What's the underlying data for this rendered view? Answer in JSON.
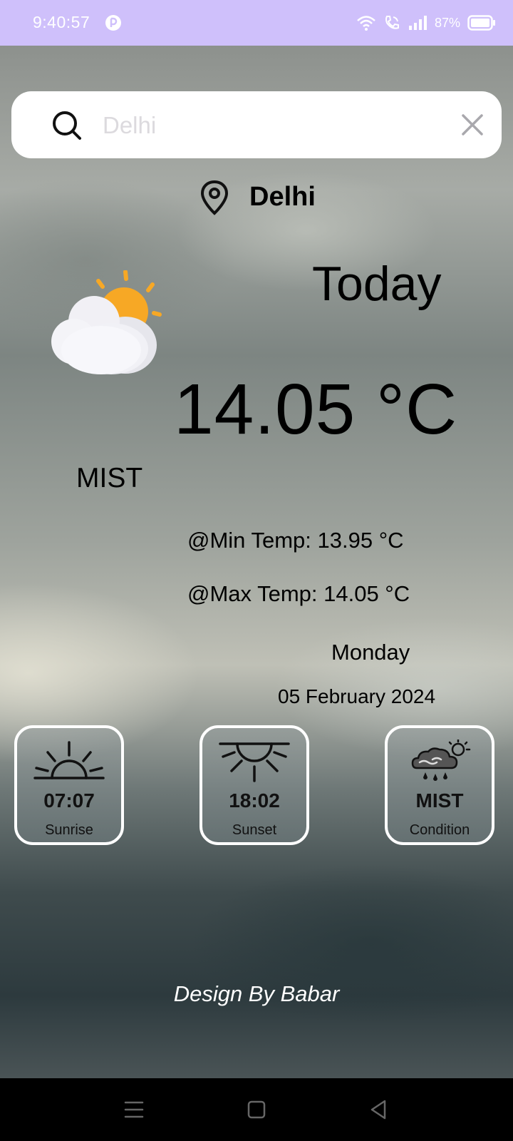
{
  "status_bar": {
    "time": "9:40:57",
    "battery_percent": "87%"
  },
  "search": {
    "placeholder": "Delhi",
    "value": ""
  },
  "location": {
    "city": "Delhi"
  },
  "weather": {
    "today_label": "Today",
    "temperature": "14.05 °C",
    "condition": "MIST",
    "min_temp": "@Min Temp: 13.95 °C",
    "max_temp": "@Max Temp: 14.05 °C",
    "day": "Monday",
    "date": "05 February 2024",
    "icon": "partly-cloudy-icon"
  },
  "cards": [
    {
      "icon": "sunrise-icon",
      "value": "07:07",
      "label": "Sunrise"
    },
    {
      "icon": "sunset-icon",
      "value": "18:02",
      "label": "Sunset"
    },
    {
      "icon": "condition-icon",
      "value": "MIST",
      "label": "Condition"
    }
  ],
  "footer": {
    "credit": "Design By Babar"
  },
  "colors": {
    "status_bar": "#cfc0fb",
    "sun": "#f7a825",
    "card_border": "#ffffff"
  }
}
